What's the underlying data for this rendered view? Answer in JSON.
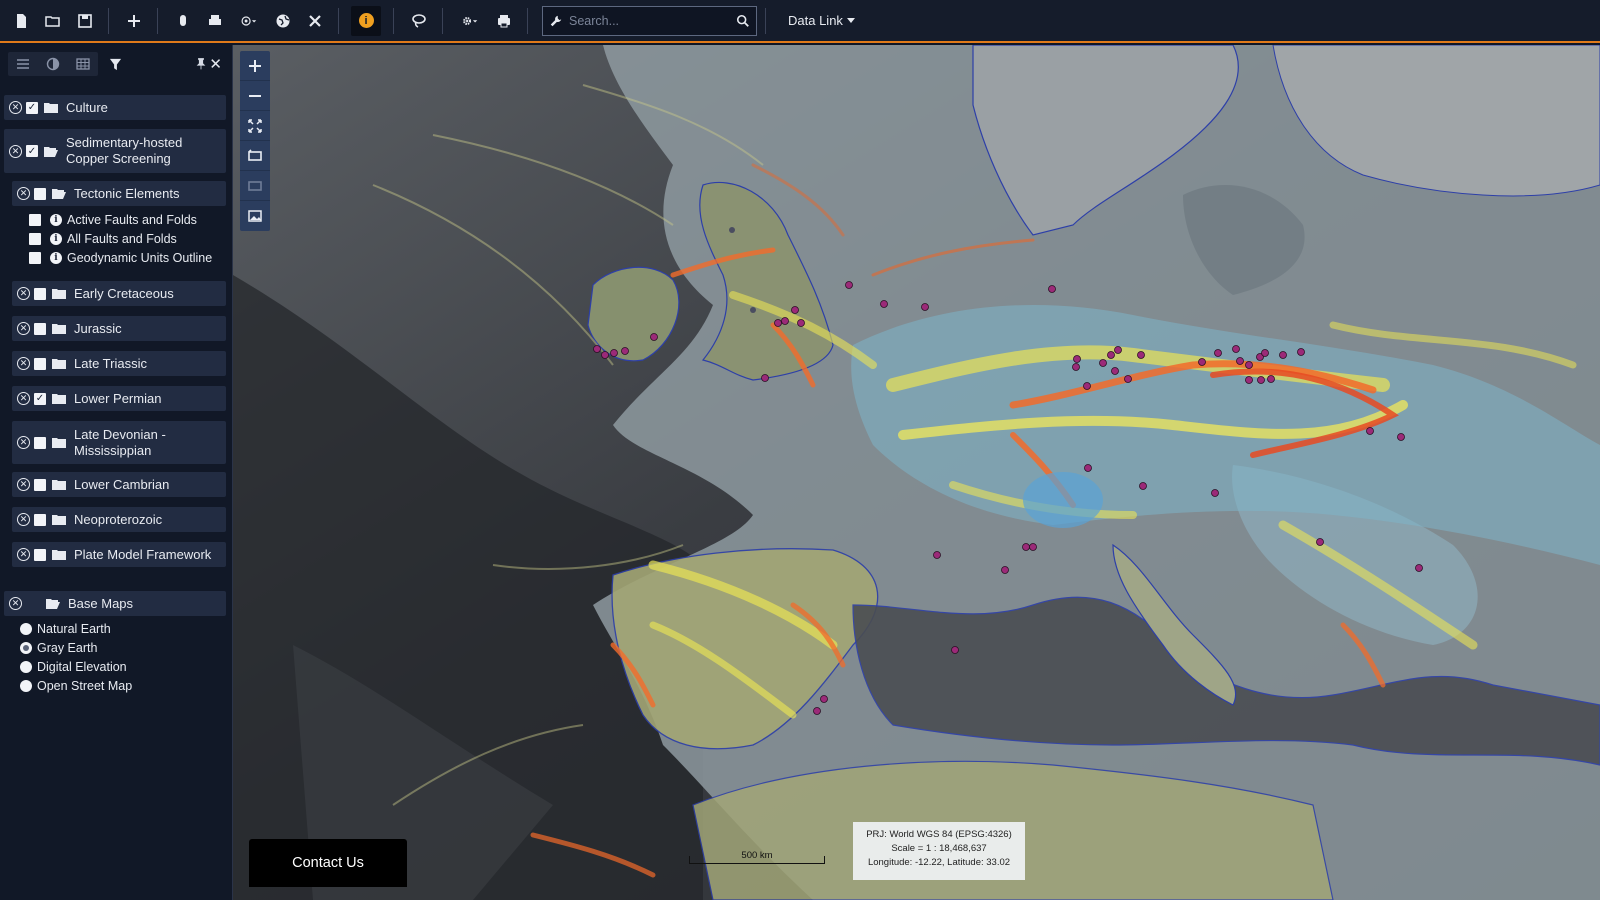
{
  "toolbar": {
    "search_placeholder": "Search...",
    "data_link_label": "Data Link",
    "icons": [
      "new-file-icon",
      "open-folder-icon",
      "save-icon",
      "add-icon",
      "mouse-icon",
      "print-icon",
      "target-icon",
      "globe-icon",
      "tools-icon",
      "info-icon",
      "lasso-icon",
      "gear-icon",
      "printer-icon",
      "wrench-icon",
      "search-icon"
    ]
  },
  "sidebar": {
    "layers": [
      {
        "label": "Culture",
        "checked": true
      },
      {
        "label": "Sedimentary-hosted Copper Screening",
        "checked": true
      },
      {
        "label": "Tectonic Elements",
        "checked": false
      },
      {
        "label": "Early Cretaceous",
        "checked": false
      },
      {
        "label": "Jurassic",
        "checked": false
      },
      {
        "label": "Late Triassic",
        "checked": false
      },
      {
        "label": "Lower Permian",
        "checked": true
      },
      {
        "label": "Late Devonian - Mississippian",
        "checked": false
      },
      {
        "label": "Lower Cambrian",
        "checked": false
      },
      {
        "label": "Neoproterozoic",
        "checked": false
      },
      {
        "label": "Plate Model Framework",
        "checked": false
      }
    ],
    "tectonic_sublayers": [
      {
        "label": "Active Faults and Folds"
      },
      {
        "label": "All Faults and Folds"
      },
      {
        "label": "Geodynamic Units Outline"
      }
    ],
    "base_maps_label": "Base Maps",
    "base_maps": [
      {
        "label": "Natural Earth",
        "selected": false
      },
      {
        "label": "Gray Earth",
        "selected": true
      },
      {
        "label": "Digital Elevation",
        "selected": false
      },
      {
        "label": "Open Street Map",
        "selected": false
      }
    ]
  },
  "map": {
    "contact_label": "Contact Us",
    "scale_bar_label": "500 km",
    "projection_line": "PRJ: World WGS 84 (EPSG:4326)",
    "scale_line": "Scale = 1 : 18,468,637",
    "coords_line": "Longitude: -12.22, Latitude: 33.02"
  },
  "colors": {
    "toolbar_bg": "#151c2b",
    "accent": "#e07a1a",
    "sidebar_bg": "#111827",
    "layer_row": "#222c42",
    "point_marker": "#9b2a78"
  }
}
